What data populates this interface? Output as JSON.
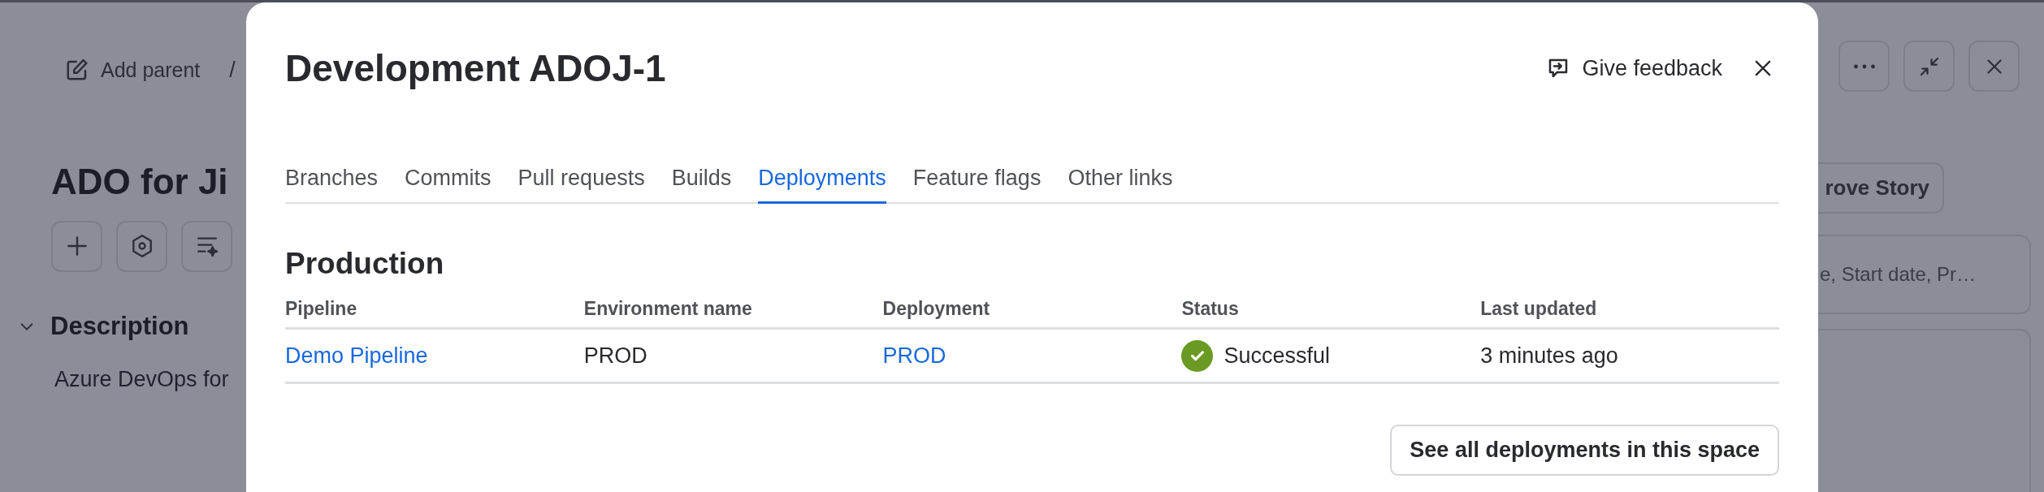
{
  "background": {
    "breadcrumb": {
      "label": "Add parent",
      "separator": "/"
    },
    "title": "ADO for Ji",
    "description": {
      "heading": "Description",
      "expanded": true,
      "text": "Azure DevOps for"
    },
    "story_button": "rove Story",
    "field_text": "e, Start date, Pr…"
  },
  "modal": {
    "title": "Development ADOJ-1",
    "feedback": "Give feedback",
    "tabs": [
      {
        "label": "Branches",
        "selected": false
      },
      {
        "label": "Commits",
        "selected": false
      },
      {
        "label": "Pull requests",
        "selected": false
      },
      {
        "label": "Builds",
        "selected": false
      },
      {
        "label": "Deployments",
        "selected": true
      },
      {
        "label": "Feature flags",
        "selected": false
      },
      {
        "label": "Other links",
        "selected": false
      }
    ],
    "section": "Production",
    "table": {
      "columns": [
        "Pipeline",
        "Environment name",
        "Deployment",
        "Status",
        "Last updated"
      ],
      "rows": [
        [
          {
            "text": "Demo Pipeline",
            "kind": "link"
          },
          {
            "text": "PROD",
            "kind": "text"
          },
          {
            "text": "PROD",
            "kind": "link"
          },
          {
            "text": "Successful",
            "kind": "status",
            "color": "#6a9a23"
          },
          {
            "text": "3 minutes ago",
            "kind": "text"
          }
        ]
      ]
    },
    "button": "See all deployments in this space"
  }
}
